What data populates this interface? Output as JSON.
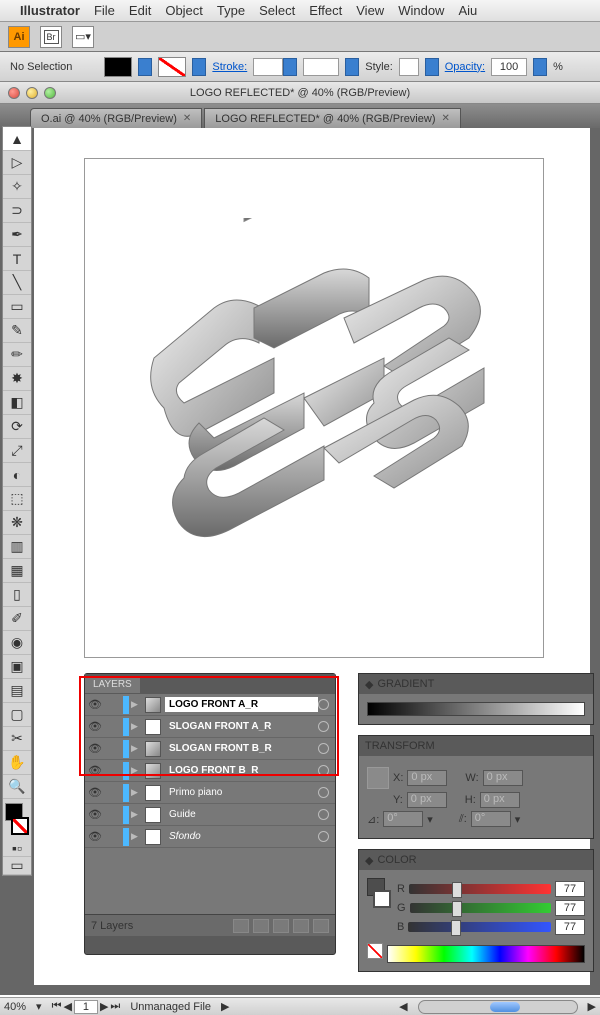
{
  "menubar": {
    "app": "Illustrator",
    "items": [
      "File",
      "Edit",
      "Object",
      "Type",
      "Select",
      "Effect",
      "View",
      "Window",
      "Aiu"
    ]
  },
  "optbar": {
    "br": "Br"
  },
  "ctrl": {
    "sel": "No Selection",
    "stroke": "Stroke:",
    "strokeVal": "",
    "style": "Style:",
    "opacity": "Opacity:",
    "opVal": "100",
    "pct": "%"
  },
  "window": {
    "title": "LOGO REFLECTED* @ 40% (RGB/Preview)"
  },
  "tabs": [
    {
      "label": "O.ai @ 40% (RGB/Preview)"
    },
    {
      "label": "LOGO REFLECTED* @ 40% (RGB/Preview)"
    }
  ],
  "layers": {
    "title": "LAYERS",
    "rows": [
      {
        "name": "LOGO FRONT A_R",
        "bold": true,
        "sel": true,
        "thumb": "grad"
      },
      {
        "name": "SLOGAN FRONT A_R",
        "bold": true,
        "thumb": "blank"
      },
      {
        "name": "SLOGAN FRONT B_R",
        "bold": true,
        "thumb": "grad"
      },
      {
        "name": "LOGO FRONT B_R",
        "bold": true,
        "thumb": "grad"
      },
      {
        "name": "Primo piano",
        "thumb": "blank"
      },
      {
        "name": "Guide",
        "thumb": "blank"
      },
      {
        "name": "Sfondo",
        "italic": true,
        "thumb": "blank"
      }
    ],
    "footer": "7 Layers"
  },
  "gradient": {
    "title": "GRADIENT"
  },
  "transform": {
    "title": "TRANSFORM",
    "x": "X:",
    "y": "Y:",
    "w": "W:",
    "h": "H:",
    "val": "0 px",
    "ang": "0°"
  },
  "color": {
    "title": "COLOR",
    "r": "R",
    "g": "G",
    "b": "B",
    "val": "77"
  },
  "status": {
    "zoom": "40%",
    "page": "1",
    "file": "Unmanaged File"
  }
}
